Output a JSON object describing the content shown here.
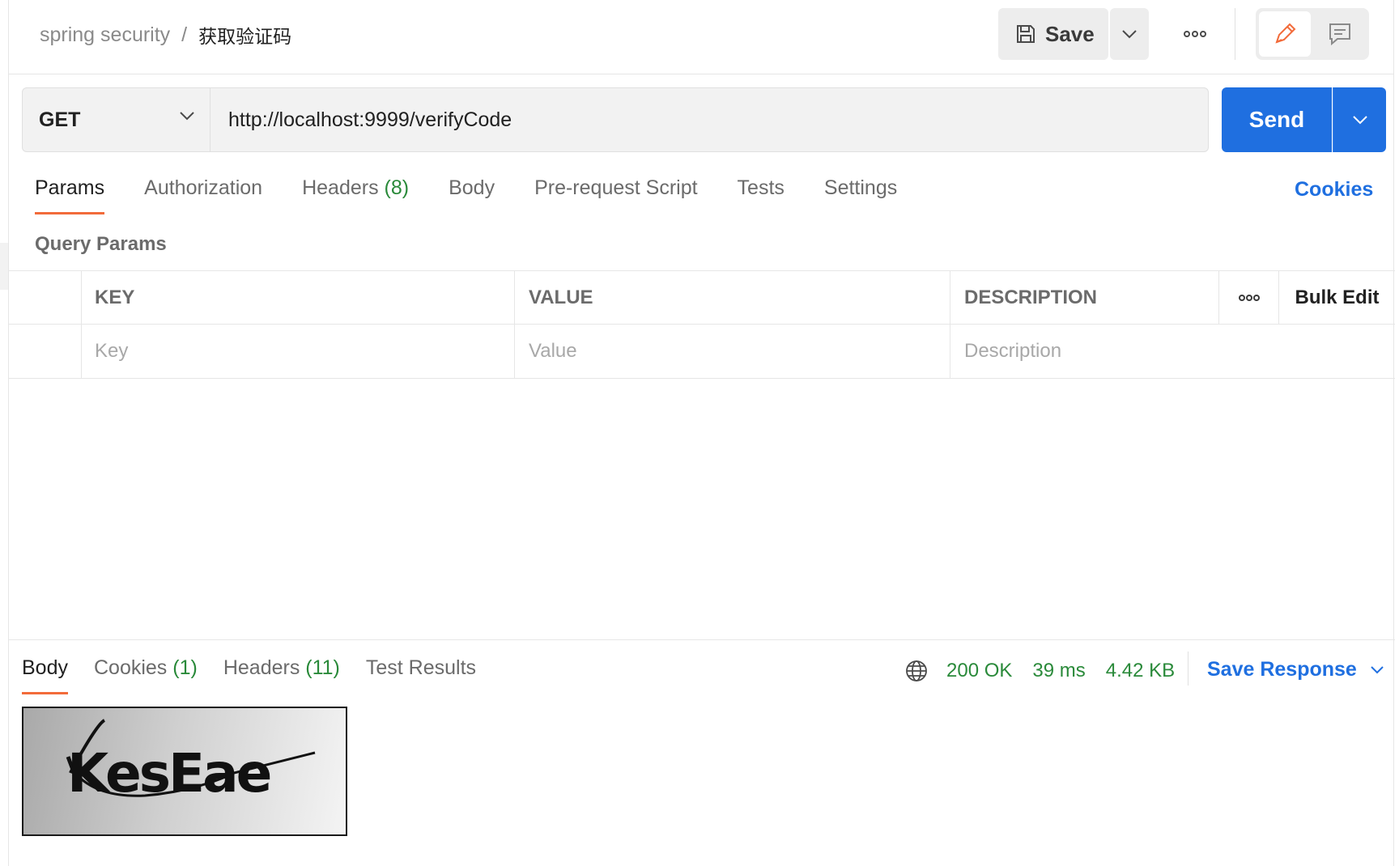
{
  "header": {
    "collection": "spring security",
    "separator": "/",
    "request_name": "获取验证码",
    "save_label": "Save"
  },
  "request": {
    "method": "GET",
    "url": "http://localhost:9999/verifyCode",
    "send_label": "Send"
  },
  "tabs": {
    "params": "Params",
    "authorization": "Authorization",
    "headers": "Headers",
    "headers_count": "(8)",
    "body": "Body",
    "prerequest": "Pre-request Script",
    "tests": "Tests",
    "settings": "Settings",
    "cookies": "Cookies"
  },
  "query_params": {
    "label": "Query Params",
    "columns": {
      "key": "KEY",
      "value": "VALUE",
      "description": "DESCRIPTION",
      "bulk_edit": "Bulk Edit"
    },
    "placeholders": {
      "key": "Key",
      "value": "Value",
      "description": "Description"
    }
  },
  "response": {
    "tabs": {
      "body": "Body",
      "cookies": "Cookies",
      "cookies_count": "(1)",
      "headers": "Headers",
      "headers_count": "(11)",
      "test_results": "Test Results"
    },
    "status": "200 OK",
    "time": "39 ms",
    "size": "4.42 KB",
    "save_response": "Save Response",
    "captcha_text": "KesEae"
  },
  "colors": {
    "accent_orange": "#f26b3a",
    "send_blue": "#1f6fe0",
    "status_green": "#2a8a3a"
  },
  "icons": [
    "save-icon",
    "chevron-down-icon",
    "more-icon",
    "pencil-icon",
    "comment-icon",
    "globe-icon"
  ]
}
